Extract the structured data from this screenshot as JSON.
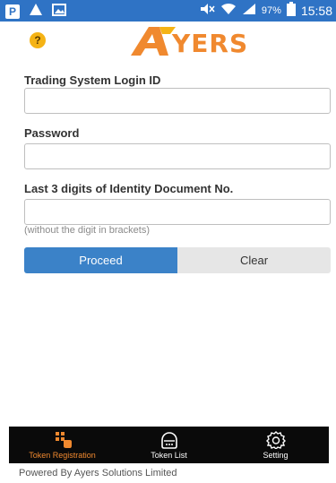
{
  "status_bar": {
    "battery": "97%",
    "time": "15:58"
  },
  "header": {
    "help_icon": "?",
    "logo_text": "YERS"
  },
  "form": {
    "login_id_label": "Trading System Login ID",
    "login_id_value": "",
    "password_label": "Password",
    "password_value": "",
    "id_digits_label": "Last 3 digits of Identity Document No.",
    "id_digits_value": "",
    "id_digits_hint": "(without the digit in brackets)",
    "proceed_label": "Proceed",
    "clear_label": "Clear"
  },
  "bottom_nav": {
    "items": [
      {
        "label": "Token Registration",
        "icon": "hand-pointer-icon",
        "active": true
      },
      {
        "label": "Token List",
        "icon": "token-device-icon",
        "active": false
      },
      {
        "label": "Setting",
        "icon": "gear-icon",
        "active": false
      }
    ]
  },
  "footer": {
    "powered_by": "Powered By Ayers Solutions Limited"
  },
  "colors": {
    "status_bar": "#2f73c5",
    "primary_button": "#3b82c8",
    "accent": "#f0892f",
    "nav_bg": "#0a0a0a"
  }
}
